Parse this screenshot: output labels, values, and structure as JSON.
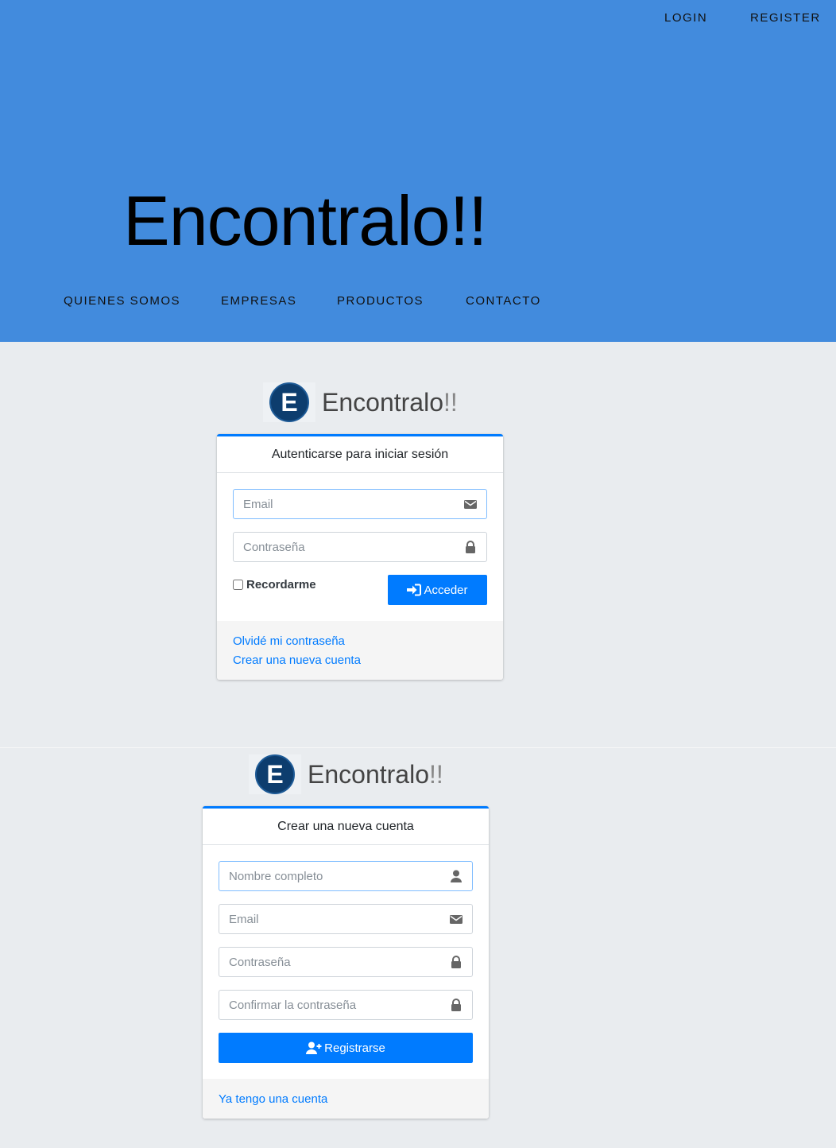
{
  "top_nav": {
    "login": "LOGIN",
    "register": "REGISTER"
  },
  "hero": {
    "title": "Encontralo!!"
  },
  "main_nav": [
    "QUIENES SOMOS",
    "EMPRESAS",
    "PRODUCTOS",
    "CONTACTO"
  ],
  "brand": {
    "letter": "E",
    "name": "Encontralo",
    "suffix": "!!"
  },
  "login_card": {
    "header": "Autenticarse para iniciar sesión",
    "email_placeholder": "Email",
    "password_placeholder": "Contraseña",
    "remember_label": "Recordarme",
    "submit_label": "Acceder",
    "forgot_link": "Olvidé mi contraseña",
    "create_link": "Crear una nueva cuenta"
  },
  "register_card": {
    "header": "Crear una nueva cuenta",
    "name_placeholder": "Nombre completo",
    "email_placeholder": "Email",
    "password_placeholder": "Contraseña",
    "confirm_placeholder": "Confirmar la contraseña",
    "submit_label": "Registrarse",
    "login_link": "Ya tengo una cuenta"
  },
  "colors": {
    "hero_bg": "#428bdd",
    "page_bg": "#e9ecef",
    "primary": "#007bff",
    "logo_circle": "#0d3d6e"
  },
  "icons": {
    "email": "envelope-icon",
    "password": "lock-icon",
    "name": "user-icon",
    "login_button": "sign-in-icon",
    "register_button": "user-plus-icon"
  }
}
